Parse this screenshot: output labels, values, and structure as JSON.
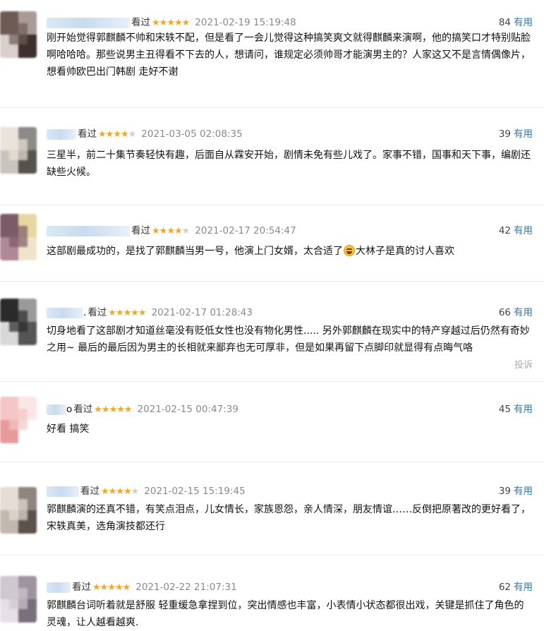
{
  "comments": [
    {
      "username_suffix": "",
      "watched": "看过",
      "rating": 5,
      "time": "2021-02-19 15:19:48",
      "votes": "84",
      "useful": "有用",
      "content": "刚开始觉得郭麒麟不帅和宋轶不配，但是看了一会儿觉得这种搞笑爽文就得麒麟来演啊，他的搞笑口才特别贴脸啊哈哈哈。那些说男主丑得看不下去的人，想请问，谁规定必须帅哥才能演男主的？人家这又不是言情偶像片，想看帅欧巴出门韩剧 走好不谢",
      "avatar_colors": [
        "#6e5a55",
        "#a99c98",
        "#d9cfcc",
        "#3c2f2c"
      ]
    },
    {
      "username_suffix": "",
      "watched": "看过",
      "rating": 4,
      "time": "2021-03-05 02:08:35",
      "votes": "39",
      "useful": "有用",
      "content": "三星半，前二十集节奏轻快有趣，后面自从霖安开始，剧情未免有些儿戏了。家事不错，国事和天下事，编剧还缺些火候。",
      "avatar_colors": [
        "#e9e3da",
        "#8c8a86",
        "#c9c5be",
        "#56524d"
      ]
    },
    {
      "username_suffix": "",
      "watched": "看过",
      "rating": 4,
      "time": "2021-02-17 20:54:47",
      "votes": "42",
      "useful": "有用",
      "content_a": "这部剧最成功的，是找了郭麒麟当男一号，他演上门女婿，太合适了",
      "content_b": "大林子是真的讨人喜欢",
      "emoji_name": "grinning-emoji",
      "avatar_colors": [
        "#7d5a68",
        "#e8d7a0",
        "#b08898",
        "#f0e4c8"
      ]
    },
    {
      "username_suffix": ".",
      "watched": "看过",
      "rating": 5,
      "time": "2021-02-17 01:28:43",
      "votes": "66",
      "useful": "有用",
      "content": "切身地看了这部剧才知道丝毫没有贬低女性也没有物化男性..... 另外郭麒麟在现实中的特产穿越过后仍然有奇妙之用~ 最后的最后因为男主的长相就来鄙弃也无可厚非，但是如果再留下点脚印就显得有点晦气咯",
      "report": "投诉",
      "avatar_colors": [
        "#2b2b2b",
        "#9a9a9a",
        "#d8d8d8",
        "#555555"
      ]
    },
    {
      "username_suffix": "o",
      "watched": "看过",
      "rating": 5,
      "time": "2021-02-15 00:47:39",
      "votes": "45",
      "useful": "有用",
      "content": "好看 搞笑",
      "avatar_colors": [
        "#f4c6c6",
        "#fbe6e6",
        "#e89a9a",
        "#ffffff"
      ]
    },
    {
      "username_suffix": "",
      "watched": "看过",
      "rating": 4,
      "time": "2021-02-15 15:19:45",
      "votes": "39",
      "useful": "有用",
      "content": "郭麒麟演的还真不错，有笑点泪点，儿女情长，家族恩怨，亲人情深，朋友情谊……反倒把原著改的更好看了，宋轶真美，选角演技都还行",
      "avatar_colors": [
        "#e5ddd6",
        "#8f857f",
        "#c2b8b0",
        "#5c524c"
      ]
    },
    {
      "username_suffix": "",
      "watched": "看过",
      "rating": 5,
      "time": "2021-02-22 21:07:31",
      "votes": "62",
      "useful": "有用",
      "content": "郭麒麟台词听着就是舒服 轻重缓急拿捏到位，突出情感也丰富，小表情小状态都很出戏，关键是抓住了角色的灵魂，让人越看越爽.",
      "avatar_colors": [
        "#cfc8cf",
        "#9e94a0",
        "#e6e0e6",
        "#7a6f7c"
      ]
    }
  ],
  "colors": {
    "star": "#f5a623",
    "link": "#3377aa",
    "time": "#8a8a8a"
  }
}
